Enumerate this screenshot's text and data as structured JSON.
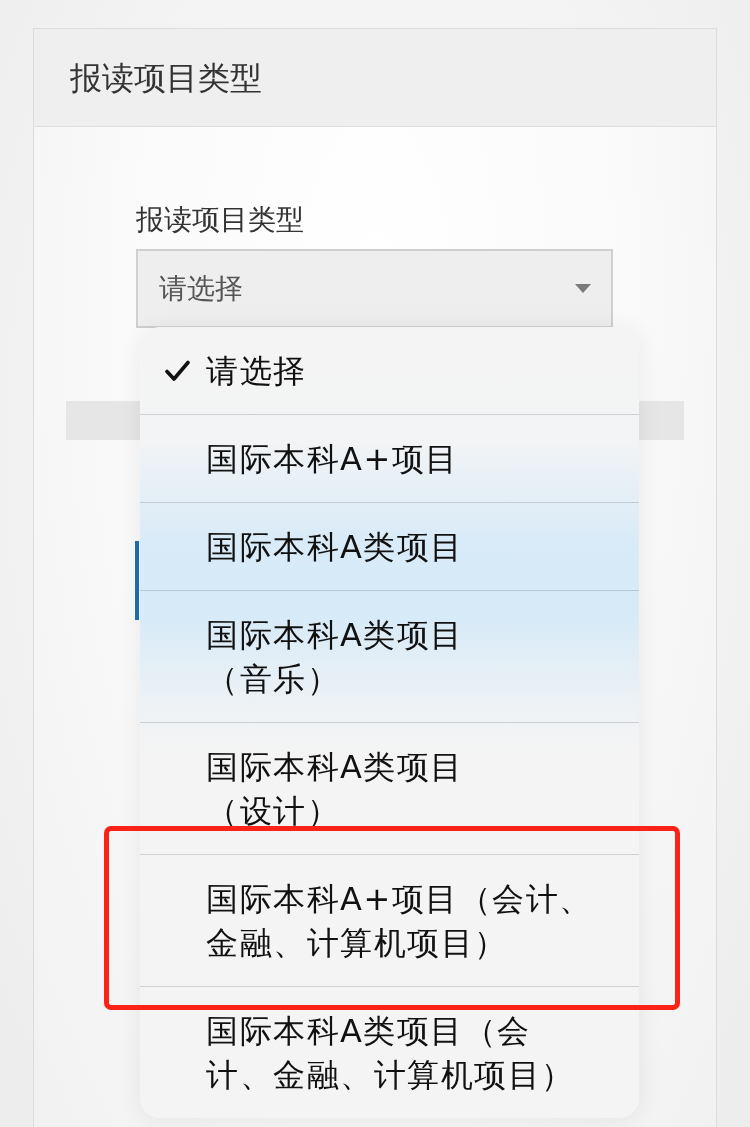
{
  "panel": {
    "title": "报读项目类型"
  },
  "field": {
    "label": "报读项目类型",
    "value": "请选择"
  },
  "picker": {
    "options": [
      {
        "label": "请选择",
        "selected": true,
        "framed": false
      },
      {
        "label": "国际本科A+项目",
        "selected": false,
        "framed": false
      },
      {
        "label": "国际本科A类项目",
        "selected": false,
        "framed": false
      },
      {
        "label": "国际本科A类项目（音乐）",
        "selected": false,
        "framed": false
      },
      {
        "label": "国际本科A类项目（设计）",
        "selected": false,
        "framed": false
      },
      {
        "label": "国际本科A+项目（会计、金融、计算机项目）",
        "selected": false,
        "framed": true
      },
      {
        "label": "国际本科A类项目（会计、金融、计算机项目）",
        "selected": false,
        "framed": false
      }
    ]
  }
}
